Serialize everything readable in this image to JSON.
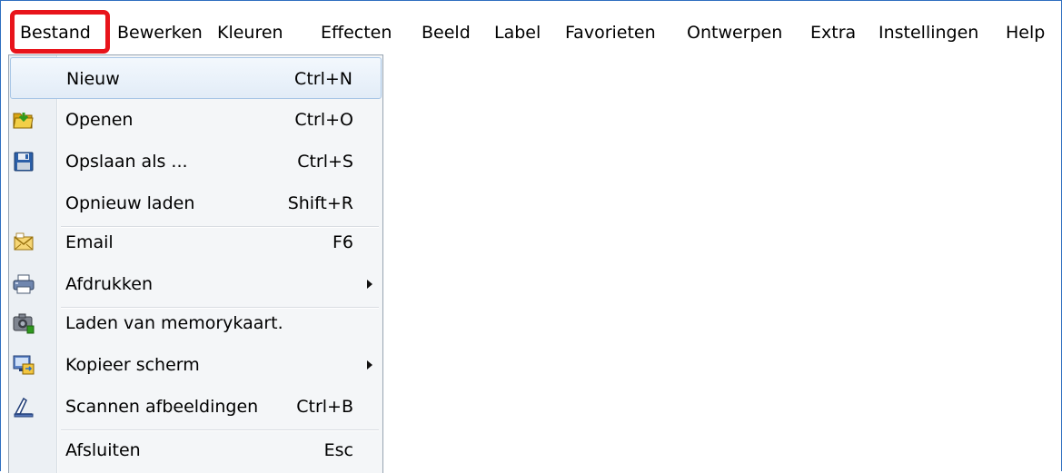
{
  "menubar": {
    "items": [
      {
        "label": "Bestand",
        "active": true
      },
      {
        "label": "Bewerken"
      },
      {
        "label": "Kleuren"
      },
      {
        "label": "Effecten"
      },
      {
        "label": "Beeld"
      },
      {
        "label": "Label"
      },
      {
        "label": "Favorieten"
      },
      {
        "label": "Ontwerpen"
      },
      {
        "label": "Extra"
      },
      {
        "label": "Instellingen"
      },
      {
        "label": "Help"
      }
    ]
  },
  "file_menu": {
    "items": [
      {
        "label": "Nieuw",
        "shortcut": "Ctrl+N",
        "icon": "none",
        "highlighted": true
      },
      {
        "label": "Openen",
        "shortcut": "Ctrl+O",
        "icon": "open-folder-icon"
      },
      {
        "label": "Opslaan als ...",
        "shortcut": "Ctrl+S",
        "icon": "floppy-disk-icon"
      },
      {
        "label": "Opnieuw laden",
        "shortcut": "Shift+R",
        "icon": "none"
      },
      {
        "label": "Email",
        "shortcut": "F6",
        "icon": "envelope-icon"
      },
      {
        "label": "Afdrukken",
        "shortcut": "",
        "icon": "printer-icon",
        "submenu": true
      },
      {
        "label": "Laden van memorykaart.",
        "shortcut": "",
        "icon": "camera-icon"
      },
      {
        "label": "Kopieer scherm",
        "shortcut": "",
        "icon": "screen-copy-icon",
        "submenu": true
      },
      {
        "label": "Scannen afbeeldingen",
        "shortcut": "Ctrl+B",
        "icon": "scanner-icon"
      },
      {
        "label": "Afsluiten",
        "shortcut": "Esc",
        "icon": "none"
      }
    ]
  },
  "colors": {
    "highlight_border": "#e8141b",
    "window_border": "#2f6fc0",
    "menu_hover_border": "#a8c6e6",
    "menu_background": "#f4f6f8"
  }
}
